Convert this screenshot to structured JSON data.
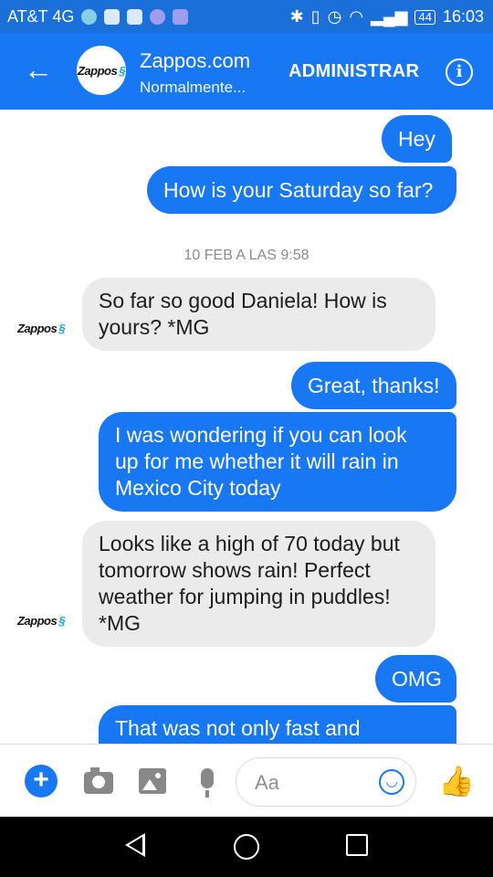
{
  "status_bar": {
    "carrier": "AT&T 4G",
    "battery": "44",
    "time": "16:03"
  },
  "header": {
    "contact_name": "Zappos.com",
    "subtitle": "Normalmente...",
    "admin_label": "ADMINISTRAR",
    "info_label": "i",
    "avatar_logo": "Zappos"
  },
  "messages": [
    {
      "from": "me",
      "text": "Hey"
    },
    {
      "from": "me",
      "text": "How is your Saturday so far?"
    },
    {
      "from": "them",
      "lines": [
        "So far so good Daniela! How is",
        "yours?  *MG"
      ]
    },
    {
      "from": "me",
      "text": "Great, thanks!"
    },
    {
      "from": "me",
      "lines": [
        "I was wondering if you can look",
        "up for me whether it will rain in",
        "Mexico City today"
      ]
    },
    {
      "from": "them",
      "lines": [
        "Looks like a high of 70 today but",
        "tomorrow shows rain! Perfect",
        "weather for jumping in puddles!",
        "*MG"
      ]
    },
    {
      "from": "me",
      "text": "OMG"
    },
    {
      "from": "me",
      "text": "That was not only fast and"
    }
  ],
  "timestamp": "10 FEB A LAS 9:58",
  "composer": {
    "placeholder": "Aa"
  },
  "colors": {
    "accent": "#1877f2",
    "status_bar": "#1a6fd8",
    "incoming_bubble": "#ebebeb"
  },
  "icons": {
    "plus": "plus-icon",
    "camera": "camera-icon",
    "image": "image-icon",
    "mic": "microphone-icon",
    "emoji": "emoji-icon",
    "like": "thumbs-up-icon"
  }
}
